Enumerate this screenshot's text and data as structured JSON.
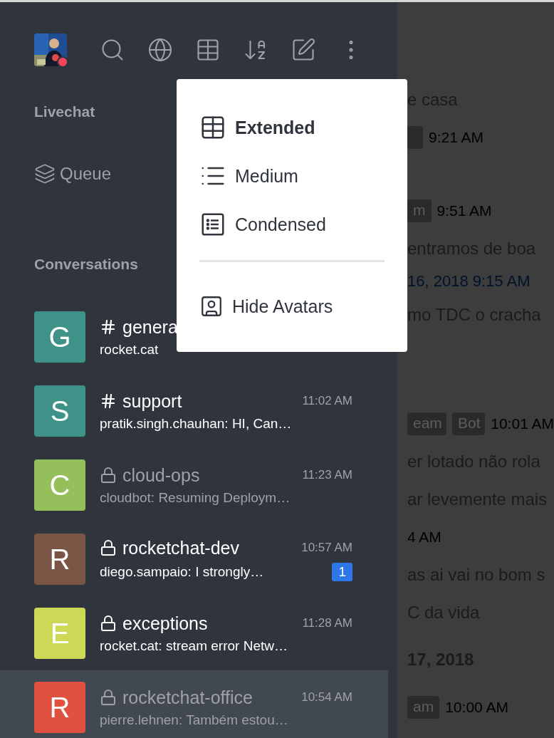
{
  "sidebar": {
    "sections": [
      {
        "title": "Livechat",
        "items": [
          {
            "label": "Queue"
          }
        ]
      },
      {
        "title": "Conversations"
      }
    ],
    "rooms": [
      {
        "initial": "G",
        "color": "#3f9287",
        "kind": "public",
        "name": "genera",
        "preview": "rocket.cat",
        "unread": true,
        "selected": false
      },
      {
        "initial": "S",
        "color": "#3f9287",
        "kind": "public",
        "name": "support",
        "time": "11:02 AM",
        "preview": "pratik.singh.chauhan: HI, Can…",
        "unread": true,
        "selected": false
      },
      {
        "initial": "C",
        "color": "#95bf5a",
        "kind": "private",
        "name": "cloud-ops",
        "time": "11:23 AM",
        "preview": "cloudbot: Resuming Deploym…",
        "unread": false,
        "selected": false
      },
      {
        "initial": "R",
        "color": "#7a5546",
        "kind": "private",
        "name": "rocketchat-dev",
        "time": "10:57 AM",
        "preview": "diego.sampaio: I strongly…",
        "unread": true,
        "selected": false,
        "badge": "1"
      },
      {
        "initial": "E",
        "color": "#cdd857",
        "kind": "private",
        "name": "exceptions",
        "time": "11:28 AM",
        "preview": "rocket.cat: stream error Netw…",
        "unread": true,
        "selected": false
      },
      {
        "initial": "R",
        "color": "#e0523f",
        "kind": "private",
        "name": "rocketchat-office",
        "time": "10:54 AM",
        "preview": "pierre.lehnen: Também estou…",
        "unread": false,
        "selected": true
      }
    ]
  },
  "menu": {
    "items": [
      {
        "kind": "option",
        "label": "Extended",
        "selected": true
      },
      {
        "kind": "option",
        "label": "Medium",
        "selected": false
      },
      {
        "kind": "option",
        "label": "Condensed",
        "selected": false
      },
      {
        "kind": "divider"
      },
      {
        "kind": "toggle",
        "label": "Hide Avatars"
      }
    ]
  },
  "chat": {
    "lines": [
      {
        "kind": "text",
        "text": "e casa"
      },
      {
        "kind": "meta",
        "hidden_badge": true,
        "time": "9:21 AM"
      },
      {
        "kind": "gap"
      },
      {
        "kind": "meta",
        "badges": [
          "m"
        ],
        "time": "9:51 AM"
      },
      {
        "kind": "text",
        "text": "entramos de boa"
      },
      {
        "kind": "link",
        "text": "16, 2018 9:15 AM"
      },
      {
        "kind": "text",
        "text": "mo TDC o cracha"
      },
      {
        "kind": "gap"
      },
      {
        "kind": "gap"
      },
      {
        "kind": "meta",
        "badges": [
          "eam",
          "Bot"
        ],
        "time": "10:01 AM"
      },
      {
        "kind": "text",
        "text": "er lotado não rola"
      },
      {
        "kind": "text",
        "text": "ar levemente mais"
      },
      {
        "kind": "meta",
        "time": "4 AM"
      },
      {
        "kind": "text",
        "text": "as ai vai no bom s"
      },
      {
        "kind": "text",
        "text": "C da vida"
      },
      {
        "kind": "date",
        "text": "17, 2018"
      },
      {
        "kind": "meta",
        "badges": [
          "am"
        ],
        "time": "10:00 AM"
      }
    ]
  }
}
